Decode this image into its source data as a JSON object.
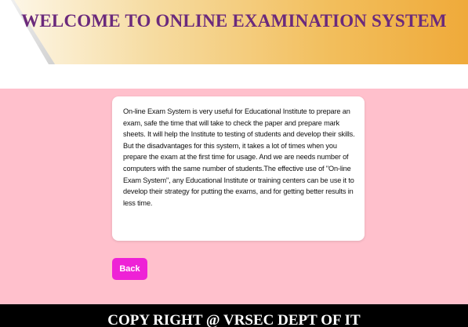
{
  "header": {
    "title": "WELCOME TO ONLINE EXAMINATION SYSTEM"
  },
  "main": {
    "description": "On-line Exam System is very useful for Educational Institute to prepare an exam, safe the time that will take to check the paper and prepare mark sheets. It will help the Institute to testing of students and develop their skills. But the disadvantages for this system, it takes a lot of times when you prepare the exam at the first time for usage. And we are needs number of computers with the same number of students.The effective use of \"On-line Exam System\", any Educational Institute or training centers can be use it to develop their strategy for putting the exams, and for getting better results in less time.",
    "back_label": "Back"
  },
  "footer": {
    "text": "COPY RIGHT @ VRSEC DEPT OF IT"
  },
  "colors": {
    "title": "#6b2a7c",
    "header_gradient_end": "#efaa3a",
    "background": "#ffc0cc",
    "back_button": "#ee22d6",
    "footer": "#000000"
  }
}
